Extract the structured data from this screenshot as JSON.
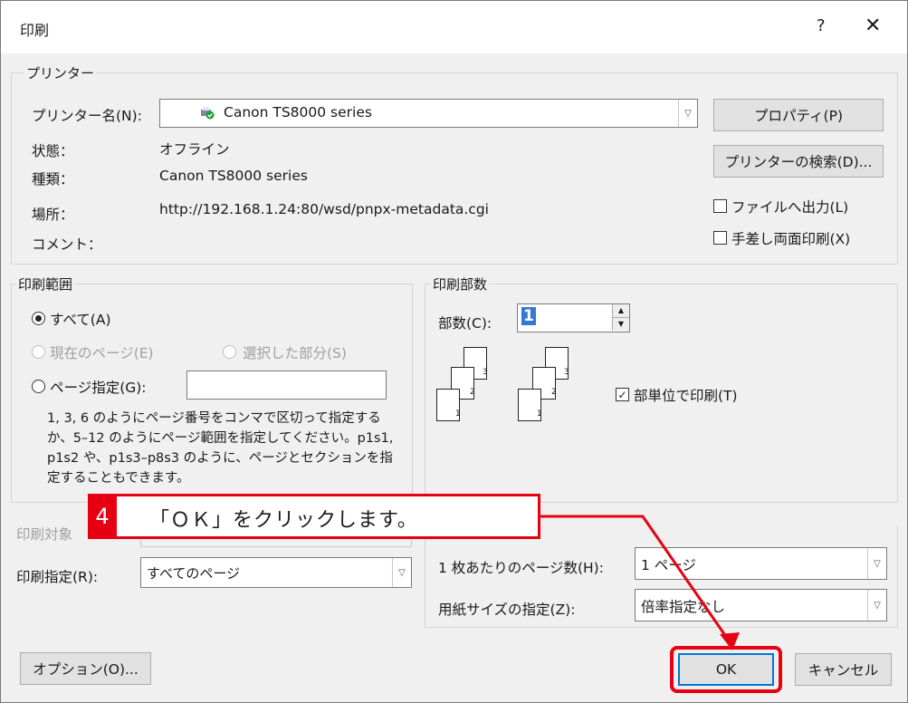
{
  "dialog": {
    "title": "印刷",
    "help_glyph": "?",
    "close_glyph": "✕"
  },
  "printer": {
    "group_label": "プリンター",
    "name_label": "プリンター名(N):",
    "name_value": "Canon TS8000 series",
    "status_label": "状態：",
    "status_value": "オフライン",
    "type_label": "種類：",
    "type_value": "Canon TS8000 series",
    "location_label": "場所：",
    "location_value": "http://192.168.1.24:80/wsd/pnpx-metadata.cgi",
    "comment_label": "コメント：",
    "properties_button": "プロパティ(P)",
    "find_button": "プリンターの検索(D)...",
    "print_to_file": "ファイルへ出力(L)",
    "manual_duplex": "手差し両面印刷(X)"
  },
  "range": {
    "group_label": "印刷範囲",
    "all": "すべて(A)",
    "current_page": "現在のページ(E)",
    "selection": "選択した部分(S)",
    "pages": "ページ指定(G):",
    "pages_value": "",
    "help_text": "1, 3, 6 のようにページ番号をコンマで区切って指定するか、5–12 のようにページ範囲を指定してください。p1s1, p1s2 や、p1s3–p8s3 のように、ページとセクションを指定することもできます。"
  },
  "copies": {
    "group_label": "印刷部数",
    "count_label": "部数(C):",
    "count_value": "1",
    "collate": "部単位で印刷(T)",
    "page_nums": [
      "1",
      "2",
      "3"
    ]
  },
  "print_what": {
    "label": "印刷対象",
    "specify_label": "印刷指定(R):",
    "specify_value": "すべてのページ"
  },
  "zoom": {
    "pages_per_sheet_label": "1 枚あたりのページ数(H):",
    "pages_per_sheet_value": "1 ページ",
    "scale_label": "用紙サイズの指定(Z):",
    "scale_value": "倍率指定なし"
  },
  "buttons": {
    "options": "オプション(O)...",
    "ok": "OK",
    "cancel": "キャンセル"
  },
  "callout": {
    "step": "4",
    "text": "「ＯＫ」をクリックします。"
  },
  "colors": {
    "accent": "#e60012",
    "dialog_bg": "#f0f0f0",
    "button_bg": "#e1e1e1"
  }
}
